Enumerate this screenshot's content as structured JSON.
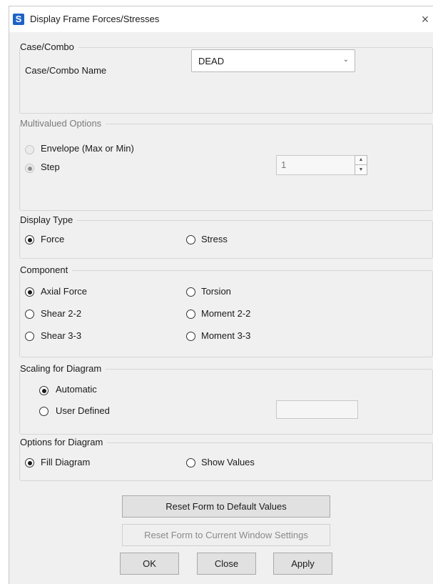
{
  "window": {
    "title": "Display Frame Forces/Stresses",
    "app_icon": "S",
    "close_glyph": "×"
  },
  "case_combo": {
    "group_label": "Case/Combo",
    "name_label": "Case/Combo Name",
    "selected": "DEAD",
    "chevron": "⌄"
  },
  "multivalued": {
    "group_label": "Multivalued Options",
    "envelope_label": "Envelope (Max or Min)",
    "step_label": "Step",
    "step_value": "1"
  },
  "display_type": {
    "group_label": "Display Type",
    "force_label": "Force",
    "stress_label": "Stress",
    "selected": "Force"
  },
  "component": {
    "group_label": "Component",
    "axial": "Axial Force",
    "torsion": "Torsion",
    "shear22": "Shear 2-2",
    "moment22": "Moment 2-2",
    "shear33": "Shear 3-3",
    "moment33": "Moment 3-3",
    "selected": "Axial Force"
  },
  "scaling": {
    "group_label": "Scaling for Diagram",
    "automatic_label": "Automatic",
    "user_defined_label": "User Defined",
    "selected": "Automatic",
    "user_value": ""
  },
  "options": {
    "group_label": "Options for Diagram",
    "fill_label": "Fill Diagram",
    "show_values_label": "Show Values",
    "selected": "Fill Diagram"
  },
  "buttons": {
    "reset_default": "Reset Form to Default Values",
    "reset_current": "Reset Form to Current Window Settings",
    "ok": "OK",
    "close": "Close",
    "apply": "Apply"
  },
  "icons": {
    "spin_up": "▲",
    "spin_down": "▼"
  }
}
